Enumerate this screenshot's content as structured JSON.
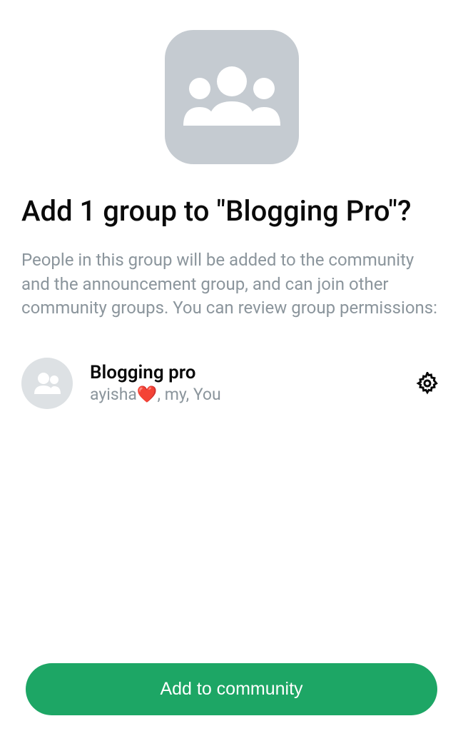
{
  "title": "Add 1 group to \"Blogging Pro\"?",
  "description": "People in this group will be added to the community and the announcement group, and can join other community groups. You can review group permissions:",
  "group": {
    "name": "Blogging pro",
    "members": "ayisha❤️, my, You"
  },
  "cta": "Add to community"
}
